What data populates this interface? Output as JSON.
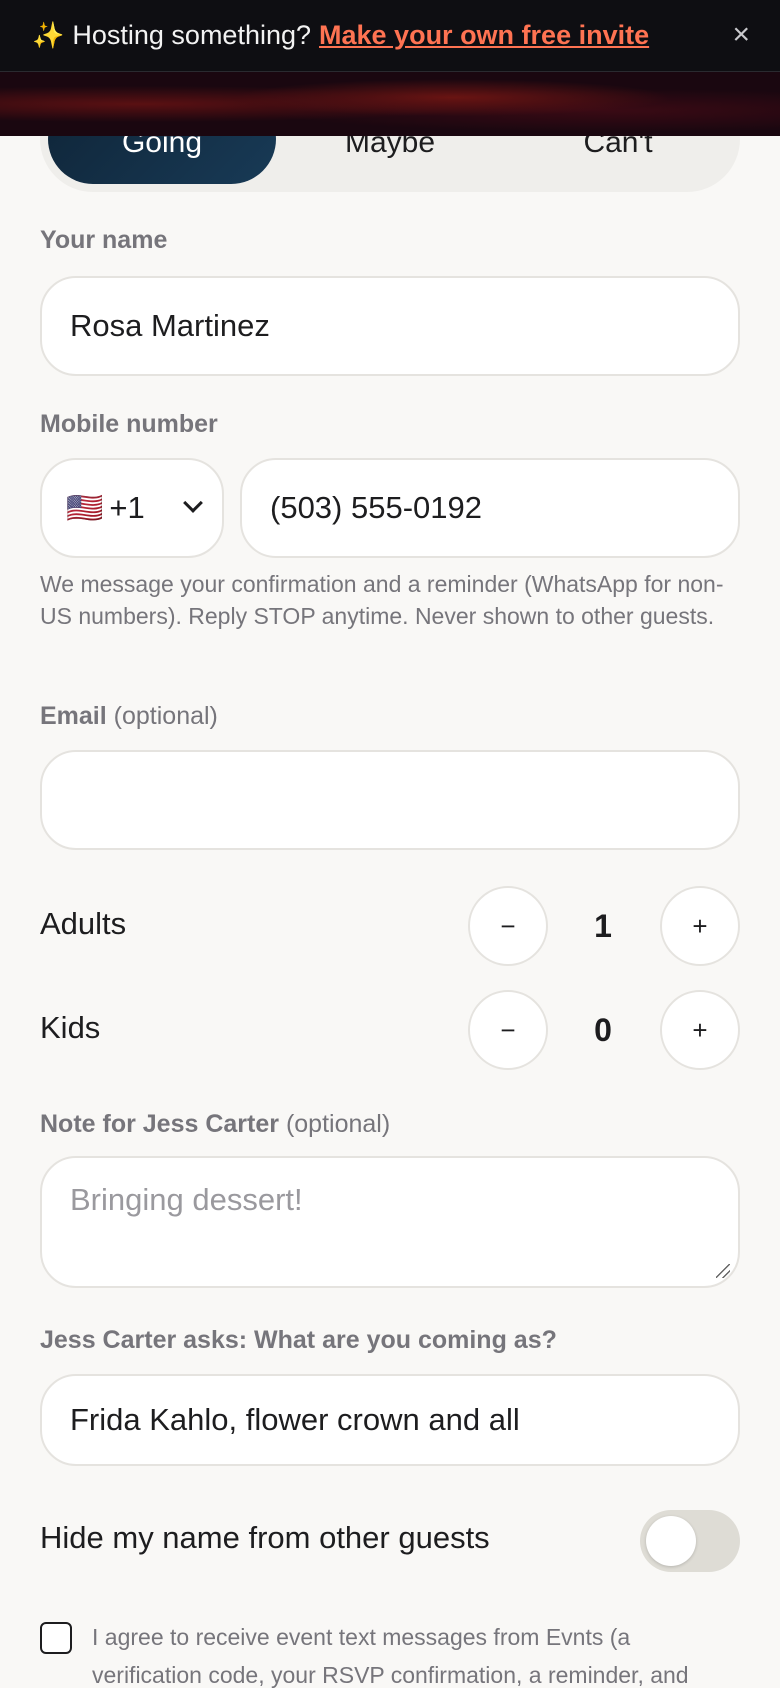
{
  "banner": {
    "sparkle": "✨",
    "text": "Hosting something?",
    "link": "Make your own free invite",
    "close": "×"
  },
  "rsvp": {
    "options": [
      "Going",
      "Maybe",
      "Can't"
    ],
    "selected": "Going"
  },
  "name": {
    "label": "Your name",
    "value": "Rosa Martinez"
  },
  "mobile": {
    "label": "Mobile number",
    "flag": "🇺🇸",
    "country_code": "+1",
    "value": "(503) 555-0192",
    "help": "We message your confirmation and a reminder (WhatsApp for non-US numbers). Reply STOP anytime. Never shown to other guests."
  },
  "email": {
    "label": "Email",
    "optional": "(optional)",
    "value": ""
  },
  "adults": {
    "label": "Adults",
    "minus": "−",
    "plus": "+",
    "value": "1"
  },
  "kids": {
    "label": "Kids",
    "minus": "−",
    "plus": "+",
    "value": "0"
  },
  "note": {
    "label": "Note for Jess Carter",
    "optional": "(optional)",
    "placeholder": "Bringing dessert!"
  },
  "question": {
    "label": "Jess Carter asks: What are you coming as?",
    "value": "Frida Kahlo, flower crown and all"
  },
  "privacy": {
    "label": "Hide my name from other guests",
    "enabled": false
  },
  "consent": {
    "checked": false,
    "text": "I agree to receive event text messages from Evnts (a verification code, your RSVP confirmation, a reminder, and"
  },
  "colors": {
    "accent_link": "#ff7352",
    "selected_segment": "#0f2538",
    "background": "#f9f8f6"
  }
}
